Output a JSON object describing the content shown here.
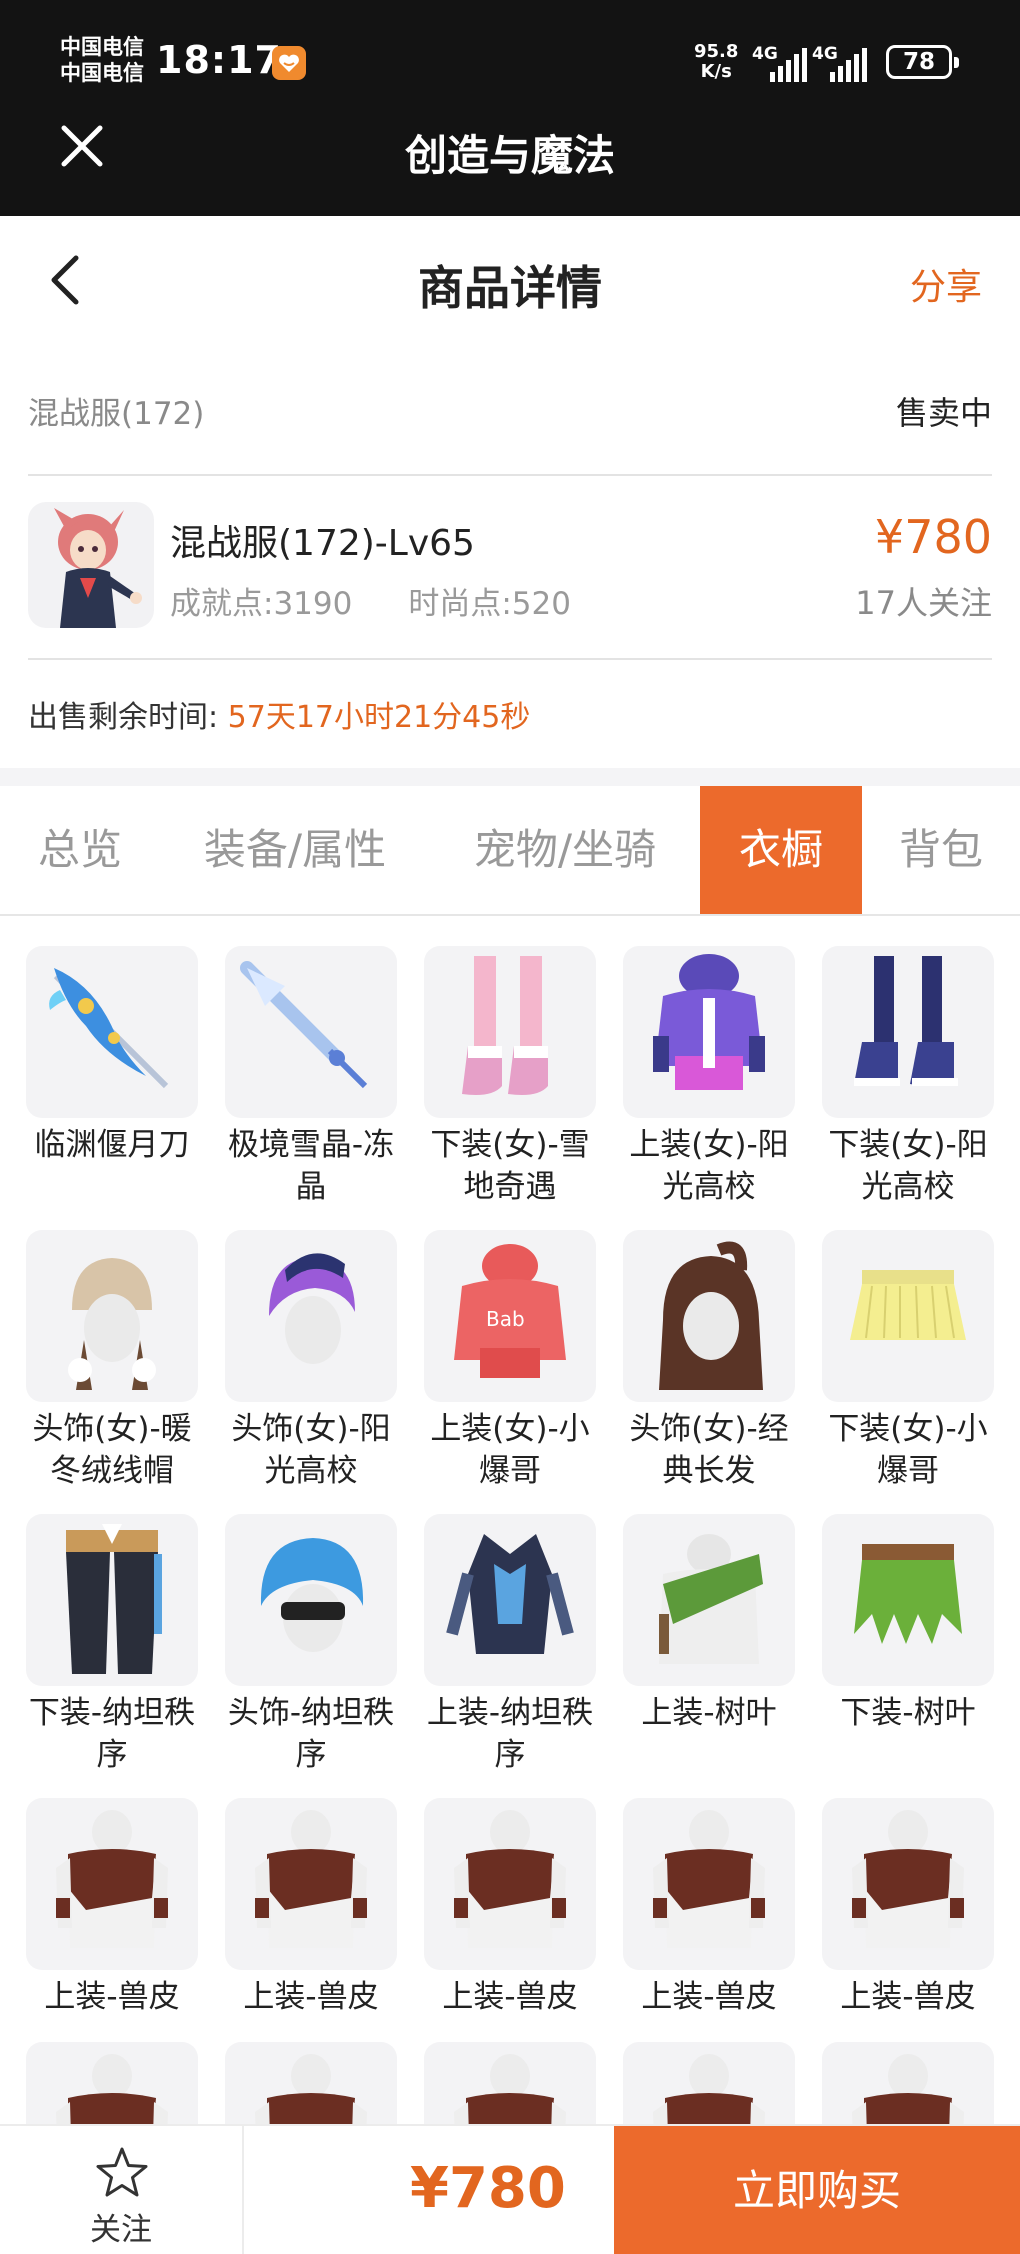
{
  "status_bar": {
    "carrier_1": "中国电信",
    "carrier_2": "中国电信",
    "time": "18:17",
    "net_speed_value": "95.8",
    "net_speed_unit": "K/s",
    "signal_1_label": "4G",
    "signal_2_label": "4G",
    "battery": "78"
  },
  "app_bar": {
    "title": "创造与魔法"
  },
  "page_header": {
    "title": "商品详情",
    "share_label": "分享"
  },
  "listing": {
    "server": "混战服(172)",
    "status": "售卖中",
    "product_name": "混战服(172)-Lv65",
    "achievement": "成就点:3190",
    "fashion": "时尚点:520",
    "price": "¥780",
    "watchers": "17人关注",
    "timer_label": "出售剩余时间:",
    "timer_value": "57天17小时21分45秒"
  },
  "tabs": [
    {
      "label": "总览",
      "active": false
    },
    {
      "label": "装备/属性",
      "active": false
    },
    {
      "label": "宠物/坐骑",
      "active": false
    },
    {
      "label": "衣橱",
      "active": true
    },
    {
      "label": "背包",
      "active": false
    }
  ],
  "wardrobe_items": [
    {
      "label": "临渊偃月刀",
      "icon": "blue-blade-icon"
    },
    {
      "label": "极境雪晶-冻晶",
      "icon": "ice-spear-icon"
    },
    {
      "label": "下装(女)-雪地奇遇",
      "icon": "pink-boots-icon"
    },
    {
      "label": "上装(女)-阳光高校",
      "icon": "purple-jacket-icon"
    },
    {
      "label": "下装(女)-阳光高校",
      "icon": "navy-sneakers-icon"
    },
    {
      "label": "头饰(女)-暖冬绒线帽",
      "icon": "knit-hat-icon"
    },
    {
      "label": "头饰(女)-阳光高校",
      "icon": "purple-hair-icon"
    },
    {
      "label": "上装(女)-小爆哥",
      "icon": "red-hoodie-icon"
    },
    {
      "label": "头饰(女)-经典长发",
      "icon": "long-hair-icon"
    },
    {
      "label": "下装(女)-小爆哥",
      "icon": "yellow-skirt-icon"
    },
    {
      "label": "下装-纳坦秩序",
      "icon": "dark-pants-icon"
    },
    {
      "label": "头饰-纳坦秩序",
      "icon": "blue-hair-icon"
    },
    {
      "label": "上装-纳坦秩序",
      "icon": "armor-icon"
    },
    {
      "label": "上装-树叶",
      "icon": "leaf-top-icon"
    },
    {
      "label": "下装-树叶",
      "icon": "leaf-skirt-icon"
    },
    {
      "label": "上装-兽皮",
      "icon": "hide-top-icon"
    },
    {
      "label": "上装-兽皮",
      "icon": "hide-top-icon"
    },
    {
      "label": "上装-兽皮",
      "icon": "hide-top-icon"
    },
    {
      "label": "上装-兽皮",
      "icon": "hide-top-icon"
    },
    {
      "label": "上装-兽皮",
      "icon": "hide-top-icon"
    },
    {
      "label": "",
      "icon": "hide-top-icon"
    },
    {
      "label": "",
      "icon": "hide-top-icon"
    },
    {
      "label": "",
      "icon": "hide-top-icon"
    },
    {
      "label": "",
      "icon": "hide-top-icon"
    },
    {
      "label": "",
      "icon": "hide-top-icon"
    }
  ],
  "bottom_bar": {
    "follow_label": "关注",
    "price": "¥780",
    "buy_label": "立即购买"
  },
  "colors": {
    "accent": "#ec6a2c",
    "price": "#e2661f",
    "bar": "#131313"
  }
}
